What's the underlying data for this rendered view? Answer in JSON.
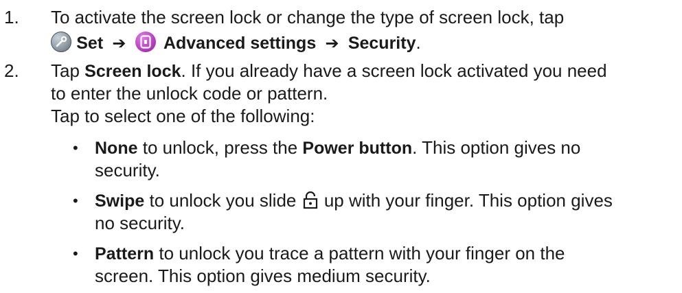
{
  "step1": {
    "number": "1.",
    "text_a": "To activate the screen lock or change the type of screen lock, tap",
    "set_label": "Set",
    "arrow1": "➔",
    "advanced_label": "Advanced settings",
    "arrow2": "➔",
    "security_label": "Security",
    "period": "."
  },
  "step2": {
    "number": "2.",
    "tap": "Tap ",
    "screen_lock": "Screen lock",
    "rest_a": ". If you already have a screen lock activated you need",
    "rest_b": "to enter the unlock code or pattern.",
    "select_prompt": "Tap to select one of the following:"
  },
  "options": [
    {
      "bullet": "•",
      "name": "None",
      "text_a": " to unlock, press the ",
      "power": "Power button",
      "text_b": ". This option gives no",
      "cont": "security."
    },
    {
      "bullet": "•",
      "name": "Swipe",
      "text_a": " to unlock you slide ",
      "text_b": " up with your finger. This option gives",
      "cont": "no security."
    },
    {
      "bullet": "•",
      "name": "Pattern",
      "text_a": " to unlock you trace a pattern with your finger on the",
      "cont": "screen. This option gives medium security."
    }
  ]
}
